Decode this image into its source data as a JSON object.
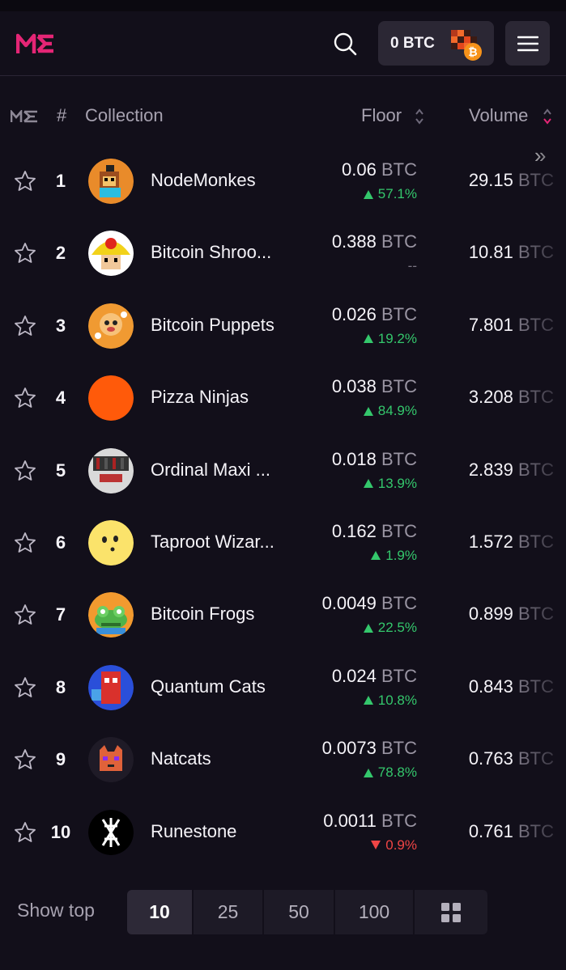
{
  "header": {
    "wallet_label": "0 BTC",
    "icons": [
      "me-logo",
      "search-icon",
      "bitcoin-icon",
      "hamburger-menu-icon"
    ]
  },
  "table": {
    "columns": {
      "hash": "#",
      "collection": "Collection",
      "floor": "Floor",
      "volume": "Volume"
    },
    "rows": [
      {
        "rank": "1",
        "name": "NodeMonkes",
        "floor": "0.06",
        "unit": "BTC",
        "change": "57.1%",
        "direction": "up",
        "volume": "29.15",
        "avatar_color": "#e98b2a"
      },
      {
        "rank": "2",
        "name": "Bitcoin Shroo...",
        "floor": "0.388",
        "unit": "BTC",
        "change": "--",
        "direction": "flat",
        "volume": "10.81",
        "avatar_color": "#f2d21a"
      },
      {
        "rank": "3",
        "name": "Bitcoin Puppets",
        "floor": "0.026",
        "unit": "BTC",
        "change": "19.2%",
        "direction": "up",
        "volume": "7.801",
        "avatar_color": "#f09a32"
      },
      {
        "rank": "4",
        "name": "Pizza Ninjas",
        "floor": "0.038",
        "unit": "BTC",
        "change": "84.9%",
        "direction": "up",
        "volume": "3.208",
        "avatar_color": "#ff5a0a"
      },
      {
        "rank": "5",
        "name": "Ordinal Maxi ...",
        "floor": "0.018",
        "unit": "BTC",
        "change": "13.9%",
        "direction": "up",
        "volume": "2.839",
        "avatar_color": "#d9d9d9"
      },
      {
        "rank": "6",
        "name": "Taproot Wizar...",
        "floor": "0.162",
        "unit": "BTC",
        "change": "1.9%",
        "direction": "up",
        "volume": "1.572",
        "avatar_color": "#fbe36b"
      },
      {
        "rank": "7",
        "name": "Bitcoin Frogs",
        "floor": "0.0049",
        "unit": "BTC",
        "change": "22.5%",
        "direction": "up",
        "volume": "0.899",
        "avatar_color": "#f29a2f"
      },
      {
        "rank": "8",
        "name": "Quantum Cats",
        "floor": "0.024",
        "unit": "BTC",
        "change": "10.8%",
        "direction": "up",
        "volume": "0.843",
        "avatar_color": "#2a4fd9"
      },
      {
        "rank": "9",
        "name": "Natcats",
        "floor": "0.0073",
        "unit": "BTC",
        "change": "78.8%",
        "direction": "up",
        "volume": "0.763",
        "avatar_color": "#1f1b27"
      },
      {
        "rank": "10",
        "name": "Runestone",
        "floor": "0.0011",
        "unit": "BTC",
        "change": "0.9%",
        "direction": "down",
        "volume": "0.761",
        "avatar_color": "#000000"
      }
    ]
  },
  "footer": {
    "show_top_label": "Show top",
    "options": [
      "10",
      "25",
      "50",
      "100"
    ],
    "selected": "10"
  },
  "colors": {
    "accent": "#e42575",
    "up": "#34c76c",
    "down": "#f04545",
    "background": "#120f1a"
  }
}
